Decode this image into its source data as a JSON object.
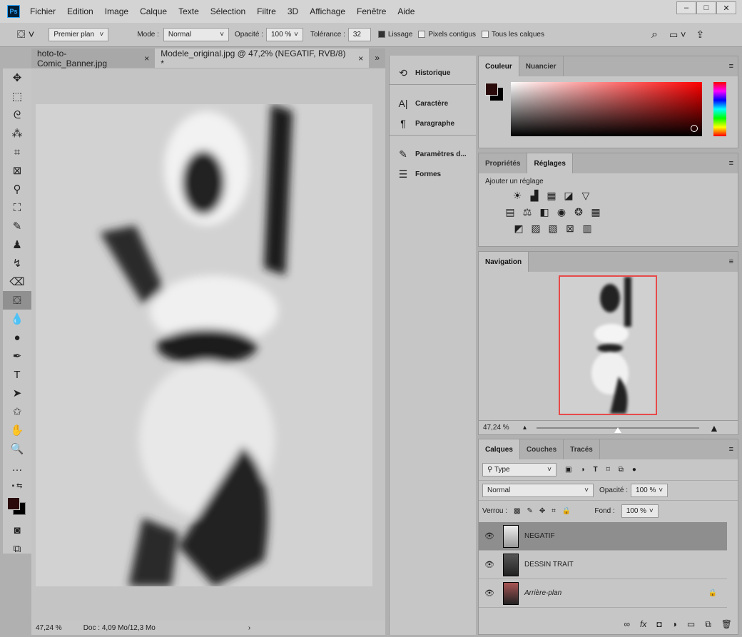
{
  "app": {
    "logo": "Ps"
  },
  "menu": [
    "Fichier",
    "Edition",
    "Image",
    "Calque",
    "Texte",
    "Sélection",
    "Filtre",
    "3D",
    "Affichage",
    "Fenêtre",
    "Aide"
  ],
  "window_buttons": [
    "–",
    "□",
    "✕"
  ],
  "options": {
    "fill_source": "Premier plan",
    "mode_label": "Mode :",
    "mode": "Normal",
    "opacity_label": "Opacité :",
    "opacity": "100 %",
    "tolerance_label": "Tolérance :",
    "tolerance": "32",
    "smoothing": "Lissage",
    "contiguous": "Pixels contigus",
    "all_layers": "Tous les calques",
    "smoothing_checked": true,
    "contiguous_checked": false,
    "all_layers_checked": false
  },
  "tabs": [
    {
      "label": "hoto-to-Comic_Banner.jpg",
      "close": "×"
    },
    {
      "label": "Modele_original.jpg @ 47,2% (NEGATIF, RVB/8) *",
      "close": "×",
      "active": true
    }
  ],
  "status": {
    "zoom": "47,24 %",
    "doc": "Doc : 4,09 Mo/12,3 Mo",
    "arrow": "›"
  },
  "dock": [
    {
      "icon": "history-icon",
      "glyph": "⟲",
      "label": "Historique"
    },
    {
      "icon": "character-icon",
      "glyph": "A|",
      "label": "Caractère"
    },
    {
      "icon": "paragraph-icon",
      "glyph": "¶",
      "label": "Paragraphe"
    },
    {
      "icon": "brush-settings-icon",
      "glyph": "✎",
      "label": "Paramètres d..."
    },
    {
      "icon": "shapes-icon",
      "glyph": "☰",
      "label": "Formes"
    }
  ],
  "color_panel": {
    "tabs": [
      "Couleur",
      "Nuancier"
    ],
    "foreground": "#2a0a0a",
    "background": "#000000",
    "hue": "#ff0000"
  },
  "adjustments": {
    "tabs": [
      "Propriétés",
      "Réglages"
    ],
    "add_label": "Ajouter un réglage"
  },
  "navigation": {
    "title": "Navigation",
    "zoom": "47,24 %",
    "zoom_fraction": 0.5,
    "view_box_color": "#e84a4a"
  },
  "layers": {
    "tabs": [
      "Calques",
      "Couches",
      "Tracés"
    ],
    "filter": "Type",
    "blend": "Normal",
    "opacity_label": "Opacité :",
    "opacity": "100 %",
    "lock_label": "Verrou :",
    "fill_label": "Fond :",
    "fill": "100 %",
    "items": [
      {
        "name": "NEGATIF",
        "selected": true
      },
      {
        "name": "DESSIN TRAIT"
      },
      {
        "name": "Arrière-plan",
        "locked": true
      }
    ]
  }
}
